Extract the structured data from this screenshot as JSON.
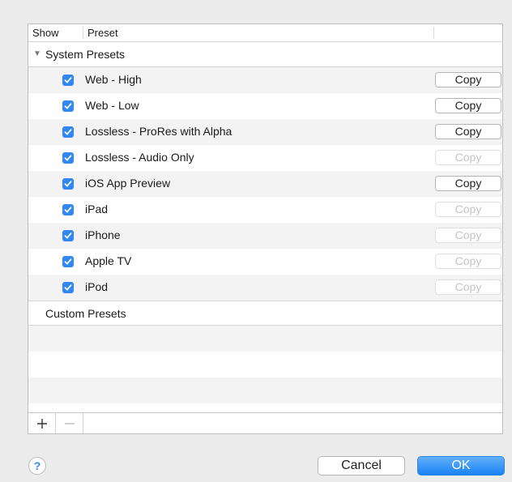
{
  "header": {
    "show": "Show",
    "preset": "Preset"
  },
  "system_group": {
    "label": "System Presets",
    "expanded": true
  },
  "presets": [
    {
      "name": "Web - High",
      "checked": true,
      "copy": "Copy",
      "copy_enabled": true
    },
    {
      "name": "Web - Low",
      "checked": true,
      "copy": "Copy",
      "copy_enabled": true
    },
    {
      "name": "Lossless - ProRes with Alpha",
      "checked": true,
      "copy": "Copy",
      "copy_enabled": true
    },
    {
      "name": "Lossless - Audio Only",
      "checked": true,
      "copy": "Copy",
      "copy_enabled": false
    },
    {
      "name": "iOS App Preview",
      "checked": true,
      "copy": "Copy",
      "copy_enabled": true
    },
    {
      "name": "iPad",
      "checked": true,
      "copy": "Copy",
      "copy_enabled": false
    },
    {
      "name": "iPhone",
      "checked": true,
      "copy": "Copy",
      "copy_enabled": false
    },
    {
      "name": "Apple TV",
      "checked": true,
      "copy": "Copy",
      "copy_enabled": false
    },
    {
      "name": "iPod",
      "checked": true,
      "copy": "Copy",
      "copy_enabled": false
    }
  ],
  "custom_group": {
    "label": "Custom Presets"
  },
  "footer": {
    "add": "+",
    "remove": "−"
  },
  "dialog": {
    "help": "?",
    "cancel": "Cancel",
    "ok": "OK"
  },
  "colors": {
    "accent": "#2f88f4",
    "ok_button": "#2a93f7"
  }
}
